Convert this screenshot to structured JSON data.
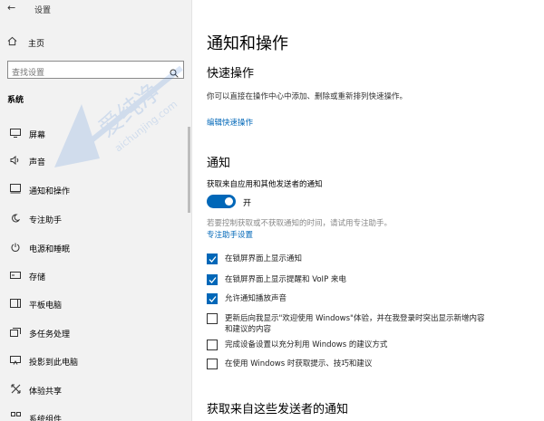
{
  "window": {
    "title": "设置",
    "minimize": "—",
    "maximize": "☐",
    "close": "✕"
  },
  "sidebar": {
    "home_label": "主页",
    "search_placeholder": "查找设置",
    "section": "系统",
    "items": [
      {
        "label": "屏幕",
        "icon": "display-icon"
      },
      {
        "label": "声音",
        "icon": "speaker-icon"
      },
      {
        "label": "通知和操作",
        "icon": "notification-icon",
        "selected": true
      },
      {
        "label": "专注助手",
        "icon": "moon-icon"
      },
      {
        "label": "电源和睡眠",
        "icon": "power-icon"
      },
      {
        "label": "存储",
        "icon": "storage-icon"
      },
      {
        "label": "平板电脑",
        "icon": "tablet-icon"
      },
      {
        "label": "多任务处理",
        "icon": "multitask-icon"
      },
      {
        "label": "投影到此电脑",
        "icon": "project-icon"
      },
      {
        "label": "体验共享",
        "icon": "share-icon"
      },
      {
        "label": "系统组件",
        "icon": "components-icon"
      }
    ]
  },
  "main": {
    "title": "通知和操作",
    "quick_actions": {
      "heading": "快速操作",
      "description": "你可以直接在操作中心中添加、删除或重新排列快速操作。",
      "edit_link": "编辑快速操作"
    },
    "notifications": {
      "heading": "通知",
      "toggle_label": "获取来自应用和其他发送者的通知",
      "toggle_state": "开",
      "toggle_on": true,
      "focus_hint": "若要控制获取或不获取通知的时间，请试用专注助手。",
      "focus_link": "专注助手设置",
      "checkboxes": [
        {
          "label": "在锁屏界面上显示通知",
          "checked": true
        },
        {
          "label": "在锁屏界面上显示提醒和 VoIP 来电",
          "checked": true
        },
        {
          "label": "允许通知播放声音",
          "checked": true
        },
        {
          "label": "更新后向我显示\"欢迎使用 Windows\"体验，并在我登录时突出显示新增内容和建议的内容",
          "checked": false
        },
        {
          "label": "完成设备设置以充分利用 Windows 的建议方式",
          "checked": false
        },
        {
          "label": "在使用 Windows 时获取提示、技巧和建议",
          "checked": false
        }
      ]
    },
    "senders_heading": "获取来自这些发送者的通知"
  },
  "watermark": {
    "text": "爱纯净",
    "url": "aichunjing.com"
  },
  "colors": {
    "accent": "#0067b8",
    "sidebar_bg": "#f2f2f2"
  }
}
